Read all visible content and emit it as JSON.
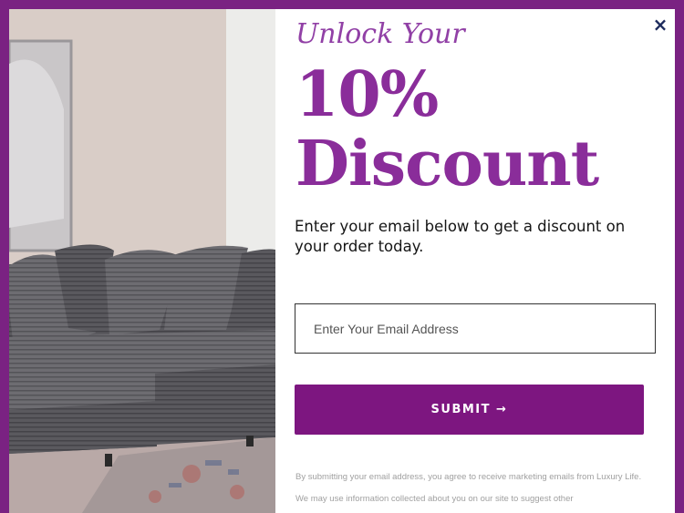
{
  "popup": {
    "close_symbol": "×",
    "eyebrow": "Unlock Your",
    "headline_line1": "10%",
    "headline_line2": "Discount",
    "subtext": "Enter your email below to get a discount on your order today.",
    "email_placeholder": "Enter Your Email Address",
    "email_value": "",
    "submit_label": "SUBMIT →",
    "disclaimer": "By submitting your email address, you agree to receive marketing emails from Luxury Life. We may use information collected about you on our site to suggest other"
  },
  "colors": {
    "frame": "#7a2282",
    "headline": "#8a2d9a",
    "button": "#7d1680",
    "close_icon": "#1c2a5c"
  },
  "icons": {
    "close": "close-icon",
    "arrow": "arrow-right-icon"
  }
}
